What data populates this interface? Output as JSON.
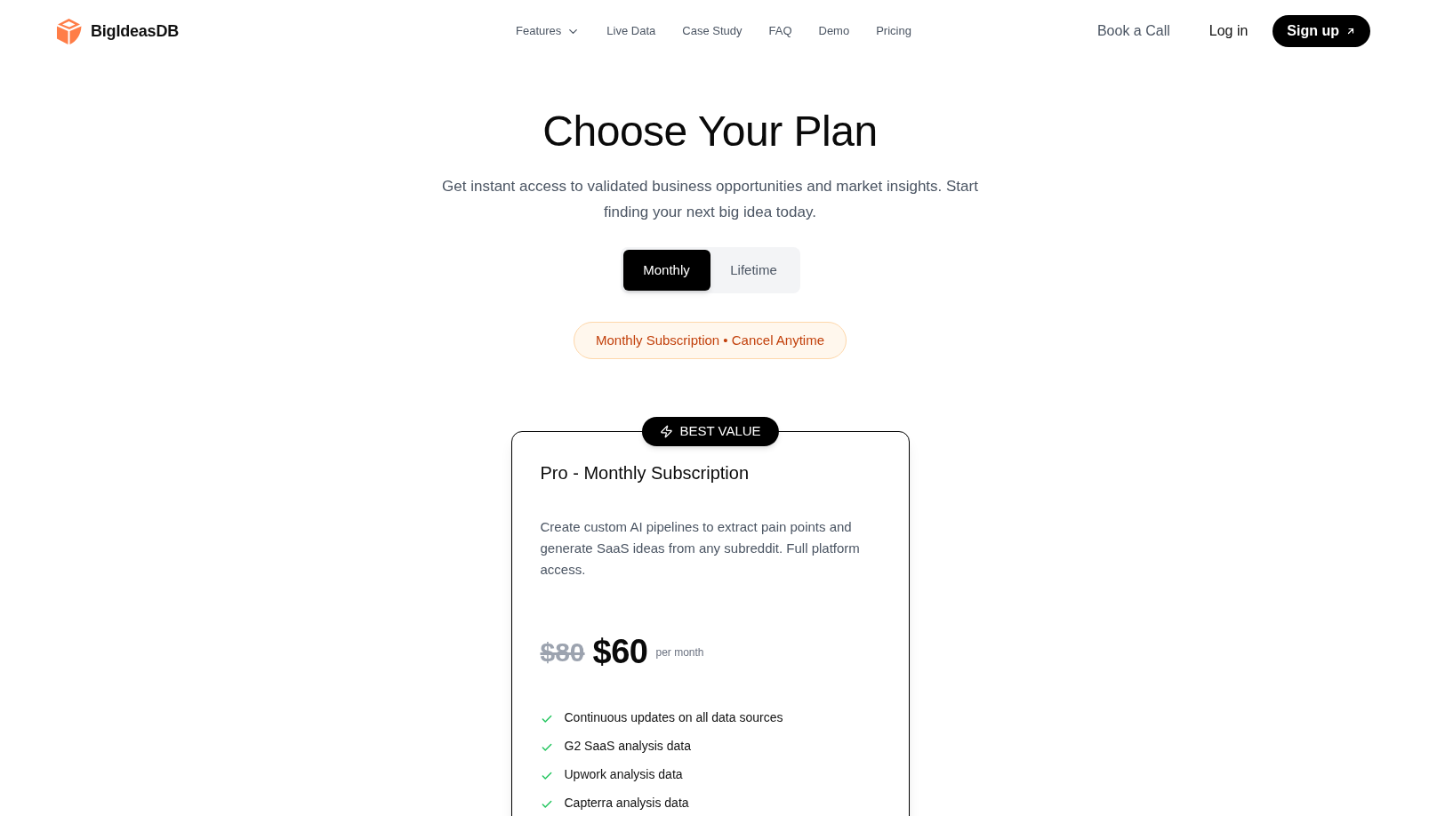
{
  "nav": {
    "brand": "BigIdeasDB",
    "links": [
      {
        "label": "Features",
        "kind": "dropdown"
      },
      {
        "label": "Live Data",
        "kind": "link"
      },
      {
        "label": "Case Study",
        "kind": "link"
      },
      {
        "label": "FAQ",
        "kind": "link"
      },
      {
        "label": "Demo",
        "kind": "link"
      },
      {
        "label": "Pricing",
        "kind": "link"
      }
    ],
    "actions": [
      {
        "label": "Book a Call",
        "kind": "muted"
      },
      {
        "label": "Log in",
        "kind": "plain"
      },
      {
        "label": "Sign up",
        "kind": "primary"
      }
    ]
  },
  "hero": {
    "title": "Choose Your Plan",
    "subtitle": "Get instant access to validated business opportunities and market insights. Start finding your next big idea today."
  },
  "billing_toggle": [
    {
      "label": "Monthly",
      "selected": true
    },
    {
      "label": "Lifetime",
      "selected": false
    }
  ],
  "billing_note": "Monthly Subscription • Cancel Anytime",
  "plans": [
    {
      "badge": "BEST VALUE",
      "name": "Pro - Monthly Subscription",
      "description": "Create custom AI pipelines to extract pain points and generate SaaS ideas from any subreddit. Full platform access.",
      "old_price": "$80",
      "price": "$60",
      "period": "per month",
      "features": [
        "Continuous updates on all data sources",
        "G2 SaaS analysis data",
        "Upwork analysis data",
        "Capterra analysis data"
      ]
    }
  ]
}
